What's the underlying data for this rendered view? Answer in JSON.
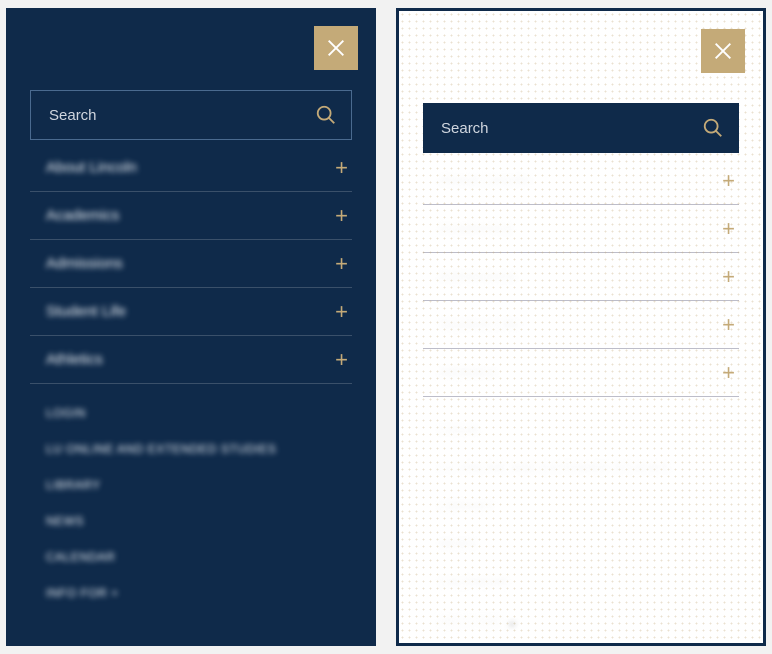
{
  "colors": {
    "navy": "#0f2a4a",
    "gold": "#c4aa78"
  },
  "left": {
    "search_placeholder": "Search",
    "menu": [
      {
        "label": "About Lincoln"
      },
      {
        "label": "Academics"
      },
      {
        "label": "Admissions"
      },
      {
        "label": "Student Life"
      },
      {
        "label": "Athletics"
      }
    ],
    "links": [
      "LOGIN",
      "LU ONLINE AND EXTENDED STUDIES",
      "LIBRARY",
      "NEWS",
      "CALENDAR",
      "INFO FOR +"
    ]
  },
  "right": {
    "search_placeholder": "Search",
    "menu": [
      {
        "label": "About Lincoln"
      },
      {
        "label": "Academics"
      },
      {
        "label": "Admissions"
      },
      {
        "label": "Student Life"
      },
      {
        "label": "Athletics"
      }
    ],
    "links": [
      "LOGIN",
      "LU ONLINE AND EXTENDED STUDIES",
      "LIBRARY",
      "NEWS",
      "CALENDAR",
      "INFO FOR"
    ]
  }
}
